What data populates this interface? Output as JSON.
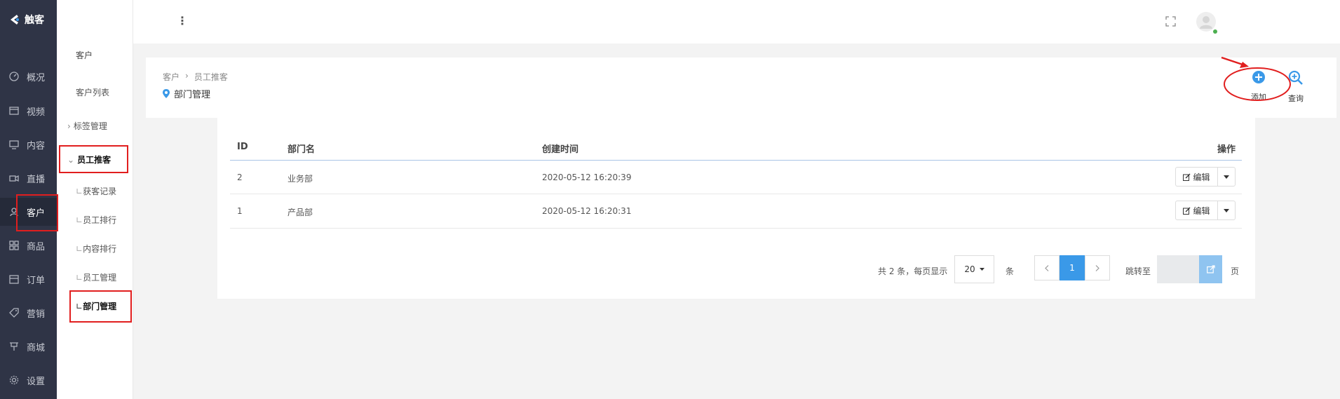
{
  "brand": {
    "name": "触客"
  },
  "nav": {
    "items": [
      {
        "label": "概况",
        "icon": "dashboard-icon"
      },
      {
        "label": "视频",
        "icon": "video-icon"
      },
      {
        "label": "内容",
        "icon": "monitor-icon"
      },
      {
        "label": "直播",
        "icon": "camera-icon"
      },
      {
        "label": "客户",
        "icon": "user-icon",
        "active": true
      },
      {
        "label": "商品",
        "icon": "grid-icon"
      },
      {
        "label": "订单",
        "icon": "calendar-icon"
      },
      {
        "label": "营销",
        "icon": "tag-icon"
      },
      {
        "label": "商城",
        "icon": "store-icon"
      },
      {
        "label": "设置",
        "icon": "gear-icon"
      }
    ]
  },
  "subnav": {
    "heading": "客户",
    "items": [
      {
        "label": "客户列表"
      },
      {
        "label": "标签管理",
        "prefix": "›"
      },
      {
        "label": "员工推客",
        "prefix": "⌄"
      },
      {
        "label": "获客记录",
        "prefix": "∟"
      },
      {
        "label": "员工排行",
        "prefix": "∟"
      },
      {
        "label": "内容排行",
        "prefix": "∟"
      },
      {
        "label": "员工管理",
        "prefix": "∟"
      },
      {
        "label": "部门管理",
        "prefix": "∟",
        "active": true
      }
    ]
  },
  "topbar": {
    "menu_icon": "⋮"
  },
  "breadcrumb": {
    "items": [
      "客户",
      "员工推客"
    ],
    "separator": "›"
  },
  "page": {
    "title": "部门管理"
  },
  "actions": {
    "add_label": "添加",
    "search_label": "查询"
  },
  "table": {
    "columns": [
      "ID",
      "部门名",
      "创建时间",
      "操作"
    ],
    "rows": [
      {
        "id": "2",
        "name": "业务部",
        "created": "2020-05-12 16:20:39",
        "edit": "编辑"
      },
      {
        "id": "1",
        "name": "产品部",
        "created": "2020-05-12 16:20:31",
        "edit": "编辑"
      }
    ]
  },
  "pagination": {
    "summary": "共 2 条，每页显示",
    "page_size": "20",
    "unit": "条",
    "current_page": "1",
    "jump_label": "跳转至",
    "page_unit": "页"
  },
  "colors": {
    "nav_bg": "#2f3446",
    "accent": "#3a99e8",
    "annotation": "#e11e1e",
    "online": "#4caf50"
  }
}
